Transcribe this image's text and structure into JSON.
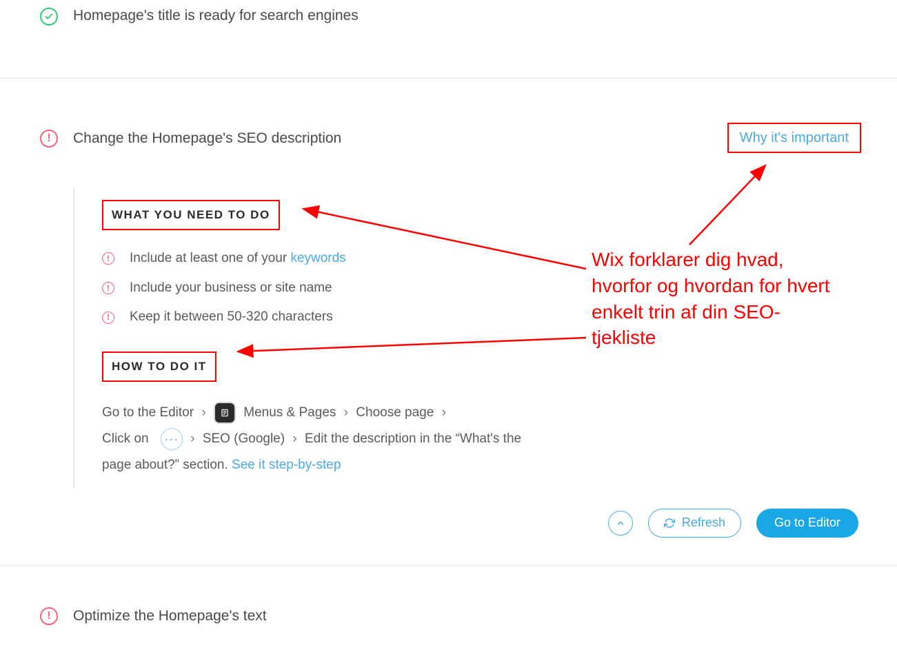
{
  "section1": {
    "title": "Homepage's title is ready for search engines"
  },
  "section2": {
    "title": "Change the Homepage's SEO description",
    "why_link": "Why it's important",
    "what_heading": "WHAT YOU NEED TO DO",
    "checklist": [
      {
        "pre": "Include at least one of your ",
        "link": "keywords",
        "post": ""
      },
      {
        "pre": "Include your business or site name",
        "link": "",
        "post": ""
      },
      {
        "pre": "Keep it between 50-320 characters",
        "link": "",
        "post": ""
      }
    ],
    "how_heading": "HOW TO DO IT",
    "how": {
      "goto": "Go to the Editor",
      "menus": "Menus & Pages",
      "choose": "Choose page",
      "click": "Click on",
      "seo": "SEO (Google)",
      "edit": "Edit the description in the “What's the page about?” section.",
      "see": "See it step-by-step"
    },
    "actions": {
      "refresh": "Refresh",
      "go_editor": "Go to Editor"
    }
  },
  "section3": {
    "title": "Optimize the Homepage's text"
  },
  "annotation": "Wix forklarer dig hvad, hvorfor og hvordan for hvert enkelt trin af din SEO-tjekliste"
}
